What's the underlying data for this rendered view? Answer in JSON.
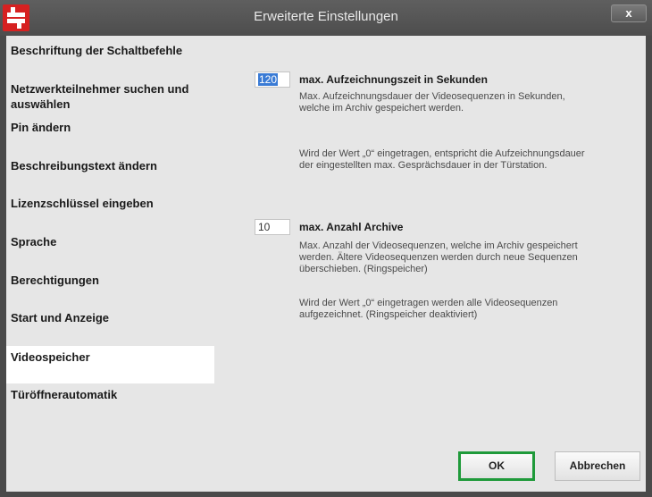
{
  "window": {
    "title": "Erweiterte Einstellungen",
    "close_label": "x",
    "logo_icon": "app-logo-icon"
  },
  "sidebar": {
    "items": [
      {
        "label": "Beschriftung der Schaltbefehle",
        "active": false
      },
      {
        "label": "Netzwerkteilnehmer suchen und auswählen",
        "active": false
      },
      {
        "label": "Pin ändern",
        "active": false
      },
      {
        "label": "Beschreibungstext ändern",
        "active": false
      },
      {
        "label": "Lizenzschlüssel eingeben",
        "active": false
      },
      {
        "label": "Sprache",
        "active": false
      },
      {
        "label": "Berechtigungen",
        "active": false
      },
      {
        "label": "Start und Anzeige",
        "active": false
      },
      {
        "label": "Videospeicher",
        "active": true
      },
      {
        "label": "Türöffnerautomatik",
        "active": false
      }
    ]
  },
  "settings": {
    "record_time": {
      "value": "120",
      "title": "max. Aufzeichnungszeit in Sekunden",
      "desc1": "Max. Aufzeichnungsdauer der Videosequenzen in Sekunden, welche im Archiv gespeichert werden.",
      "desc2": "Wird der Wert „0“ eingetragen, entspricht die Aufzeichnungsdauer der eingestellten max. Gesprächsdauer in der Türstation."
    },
    "archive_count": {
      "value": "10",
      "title": "max. Anzahl Archive",
      "desc1": "Max. Anzahl der Videosequenzen, welche im Archiv gespeichert werden. Ältere Videosequenzen werden durch neue Sequenzen überschieben. (Ringspeicher)",
      "desc2": "Wird der Wert „0“ eingetragen werden alle Videosequenzen aufgezeichnet. (Ringspeicher deaktiviert)"
    }
  },
  "buttons": {
    "ok": "OK",
    "cancel": "Abbrechen"
  },
  "colors": {
    "ok_border": "#1f9a3a",
    "logo": "#d62121",
    "selection": "#3a7bd5"
  }
}
